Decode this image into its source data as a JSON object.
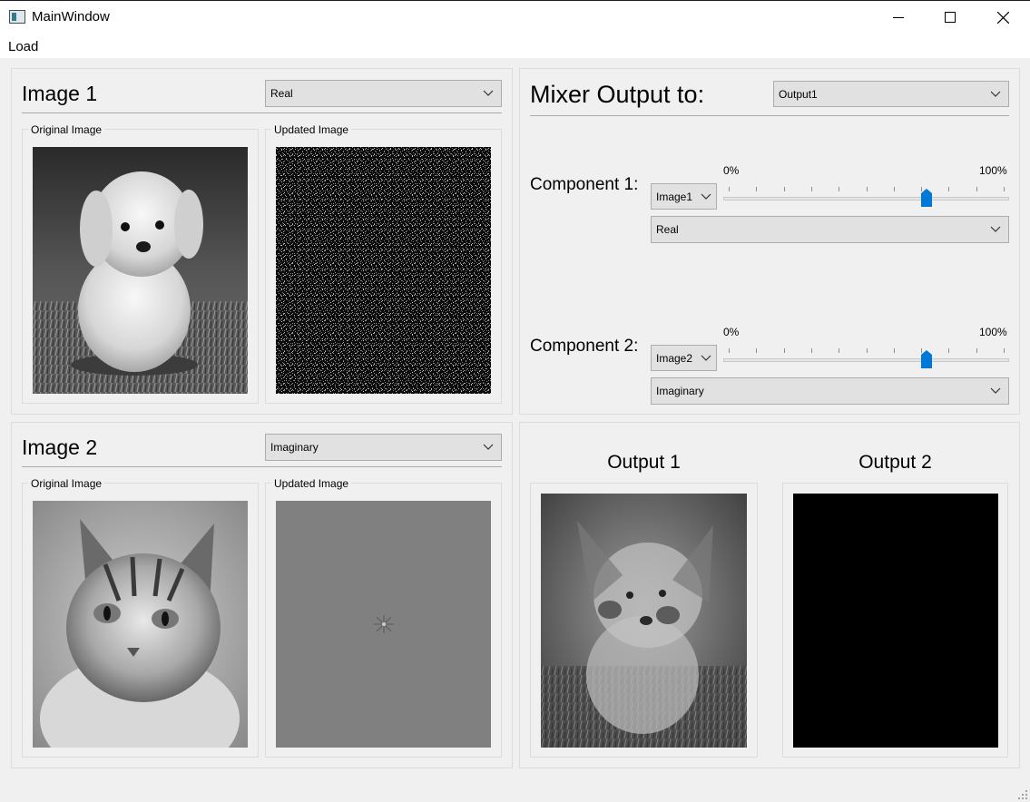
{
  "window": {
    "title": "MainWindow",
    "controls": [
      "minimize-icon",
      "maximize-icon",
      "close-icon"
    ]
  },
  "menu": {
    "load": "Load"
  },
  "image1": {
    "title": "Image 1",
    "component_select": "Real",
    "original_label": "Original Image",
    "updated_label": "Updated Image"
  },
  "image2": {
    "title": "Image 2",
    "component_select": "Imaginary",
    "original_label": "Original Image",
    "updated_label": "Updated Image"
  },
  "mixer": {
    "output_to_label": "Mixer Output to:",
    "output_select": "Output1",
    "component1": {
      "label": "Component 1:",
      "image_select": "Image1",
      "slider_min_label": "0%",
      "slider_max_label": "100%",
      "slider_value_percent": 72,
      "type_select": "Real"
    },
    "component2": {
      "label": "Component 2:",
      "image_select": "Image2",
      "slider_min_label": "0%",
      "slider_max_label": "100%",
      "slider_value_percent": 72,
      "type_select": "Imaginary"
    }
  },
  "outputs": {
    "output1_title": "Output 1",
    "output2_title": "Output 2"
  },
  "colors": {
    "window_bg": "#f0f0f0",
    "slider_thumb": "#0078d7",
    "combo_bg": "#e1e1e1"
  }
}
